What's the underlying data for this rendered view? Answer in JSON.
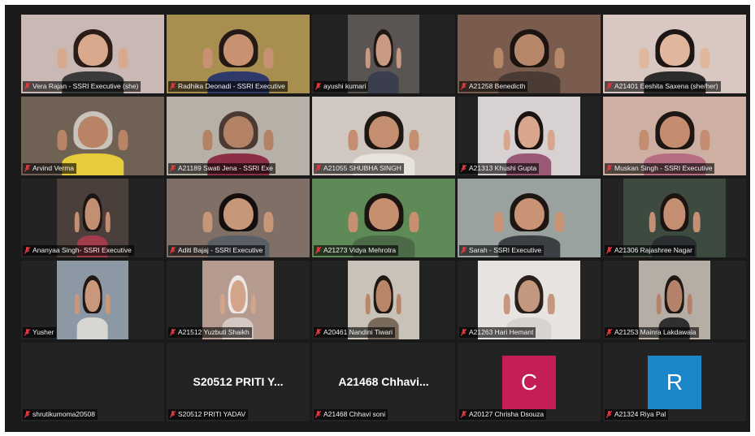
{
  "meeting": {
    "rows": [
      [
        {
          "name": "Vera Rajan - SSRI Executive (she)",
          "bg": "#c9b8b3",
          "skin": "#d9a98d",
          "hair": "#2a1c17",
          "shirt": "#3a3a3a"
        },
        {
          "name": "Radhika Deonadi - SSRI Executive",
          "bg": "#a88e4f",
          "skin": "#c89272",
          "hair": "#241915",
          "shirt": "#303a6a",
          "active": true
        },
        {
          "name": "ayushi kumari",
          "bg": "#5a5452",
          "skin": "#c99a82",
          "hair": "#1e1714",
          "shirt": "#3b3f4d",
          "frame": "narrow"
        },
        {
          "name": "A21258 Benedicth",
          "bg": "#7a5c4e",
          "skin": "#b7876a",
          "hair": "#1b1411",
          "shirt": "#4a3b35"
        },
        {
          "name": "A21401 Eeshita Saxena (she/her)",
          "bg": "#d9c7c2",
          "skin": "#e0b69c",
          "hair": "#1d1614",
          "shirt": "#2c2c2c"
        }
      ],
      [
        {
          "name": "Arvind Verma",
          "bg": "#6f6255",
          "skin": "#b98466",
          "hair": "#c8c4bc",
          "shirt": "#e6cb3a"
        },
        {
          "name": "A21189 Swati Jena - SSRI Exe",
          "bg": "#b7b0a6",
          "skin": "#b48366",
          "hair": "#4a3a33",
          "shirt": "#8a2f45"
        },
        {
          "name": "A21055 SHUBHA SINGH",
          "bg": "#cfc7c0",
          "skin": "#c48e70",
          "hair": "#1f1713",
          "shirt": "#e8e2dc"
        },
        {
          "name": "A21313 Khushi Gupta",
          "bg": "#d8d1d2",
          "skin": "#d7a68c",
          "hair": "#1a1311",
          "shirt": "#9a5a77",
          "frame": "mid"
        },
        {
          "name": "Muskan Singh - SSRI Executive",
          "bg": "#cdb0a3",
          "skin": "#c58d6f",
          "hair": "#1e1613",
          "shirt": "#b66e82"
        }
      ],
      [
        {
          "name": "Ananyaa Singh- SSRI Executive",
          "bg": "#4a3f3a",
          "skin": "#c38f72",
          "hair": "#1d1512",
          "shirt": "#a23b4b",
          "frame": "narrow"
        },
        {
          "name": "Aditi Bajaj - SSRI Executive",
          "bg": "#7f6f66",
          "skin": "#c69678",
          "hair": "#140f0d",
          "shirt": "#5a5f66"
        },
        {
          "name": "A21273 Vidya Mehrotra",
          "bg": "#5d8a56",
          "skin": "#c68f6f",
          "hair": "#1c1411",
          "shirt": "#4c6a47"
        },
        {
          "name": "Sarah - SSRI Executive",
          "bg": "#9aa2a0",
          "skin": "#c99376",
          "hair": "#1d1613",
          "shirt": "#3c3f44"
        },
        {
          "name": "A21306 Rajashree Nagar",
          "bg": "#3c4a40",
          "skin": "#c48f72",
          "hair": "#1b1411",
          "shirt": "#2b2f32",
          "frame": "mid"
        }
      ],
      [
        {
          "name": "Yusher",
          "bg": "#8c98a3",
          "skin": "#c9987c",
          "hair": "#1e1715",
          "shirt": "#d8d6d3",
          "frame": "narrow"
        },
        {
          "name": "A21512 Yuzbuti Shaikh",
          "bg": "#b59a8f",
          "skin": "#d2a58b",
          "hair": "#ece6e4",
          "shirt": "#d6c9c3",
          "frame": "narrow"
        },
        {
          "name": "A20461 Nandini Tiwari",
          "bg": "#c9c2b8",
          "skin": "#b98669",
          "hair": "#1f1713",
          "shirt": "#7a6a5c",
          "frame": "narrow"
        },
        {
          "name": "A21263 Hari Hemant",
          "bg": "#e7e3e0",
          "skin": "#c4987f",
          "hair": "#2a201b",
          "shirt": "#d9d3cf",
          "frame": "mid"
        },
        {
          "name": "A21253 Mainra Lakdawala",
          "bg": "#b6aea5",
          "skin": "#b4826a",
          "hair": "#1e1714",
          "shirt": "#2f2f2f",
          "frame": "narrow"
        }
      ],
      [
        {
          "name": "shrutikumoma20508",
          "type": "blank"
        },
        {
          "name": "S20512 PRITI YADAV",
          "type": "text",
          "display": "S20512  PRITI Y..."
        },
        {
          "name": "A21468 Chhavi soni",
          "type": "text",
          "display": "A21468  Chhavi..."
        },
        {
          "name": "A20127 Chrisha Dsouza",
          "type": "avatar",
          "letter": "C",
          "color": "#c41e57"
        },
        {
          "name": "A21324 Riya Pal",
          "type": "avatar",
          "letter": "R",
          "color": "#1b86c9"
        }
      ]
    ]
  }
}
